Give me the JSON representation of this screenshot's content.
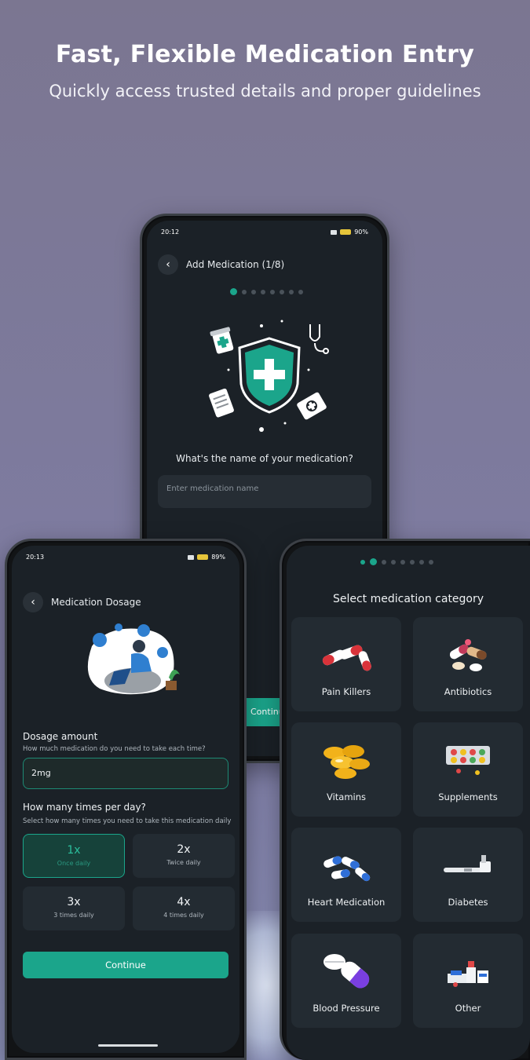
{
  "headline": "Fast, Flexible Medication Entry",
  "subheadline": "Quickly access trusted details and proper guidelines",
  "phone1": {
    "time": "20:12",
    "battery": "90%",
    "title": "Add Medication (1/8)",
    "question": "What's the name of your medication?",
    "name_placeholder": "Enter medication name",
    "continue_label": "Continu",
    "step_count": 8,
    "active_step": 1
  },
  "phone2": {
    "time": "20:13",
    "battery": "89%",
    "title": "Medication Dosage",
    "dosage_title": "Dosage amount",
    "dosage_help": "How much medication do you need to take each time?",
    "dosage_value": "2mg",
    "times_title": "How many times per day?",
    "times_help": "Select how many times you need to take this medication daily",
    "options": [
      {
        "big": "1x",
        "small": "Once daily",
        "selected": true
      },
      {
        "big": "2x",
        "small": "Twice daily",
        "selected": false
      },
      {
        "big": "3x",
        "small": "3 times daily",
        "selected": false
      },
      {
        "big": "4x",
        "small": "4 times daily",
        "selected": false
      }
    ],
    "continue_label": "Continue"
  },
  "phone3": {
    "title": "Select medication category",
    "categories": [
      {
        "label": "Pain Killers",
        "icon": "pills-icon"
      },
      {
        "label": "Antibiotics",
        "icon": "capsules-icon"
      },
      {
        "label": "Vitamins",
        "icon": "softgels-icon"
      },
      {
        "label": "Supplements",
        "icon": "blister-pack-icon"
      },
      {
        "label": "Heart Medication",
        "icon": "blue-capsules-icon"
      },
      {
        "label": "Diabetes",
        "icon": "insulin-pen-icon"
      },
      {
        "label": "Blood Pressure",
        "icon": "pill-capsule-icon"
      },
      {
        "label": "Other",
        "icon": "medicine-box-icon"
      }
    ]
  },
  "colors": {
    "accent": "#1ba58b",
    "screen_bg": "#1b2127",
    "card_bg": "#232b32"
  }
}
